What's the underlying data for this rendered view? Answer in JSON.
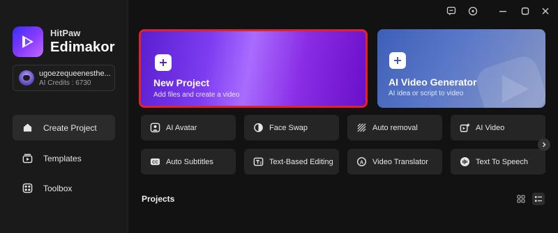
{
  "app": {
    "brand_small": "HitPaw",
    "brand_big": "Edimakor",
    "logo_icon": "play-triangle-icon"
  },
  "account": {
    "name": "ugoezequeenesthe...",
    "credits": "AI Credits : 6730"
  },
  "sidebar": {
    "items": [
      {
        "label": "Create Project",
        "icon": "home-icon",
        "active": true
      },
      {
        "label": "Templates",
        "icon": "templates-icon",
        "active": false
      },
      {
        "label": "Toolbox",
        "icon": "toolbox-icon",
        "active": false
      }
    ]
  },
  "titlebar": {
    "icons": [
      "feedback-icon",
      "settings-icon",
      "minimize-icon",
      "maximize-icon",
      "close-icon"
    ]
  },
  "hero": {
    "new_project": {
      "title": "New Project",
      "subtitle": "Add files and create a video"
    },
    "ai_video_generator": {
      "title": "AI Video Generator",
      "subtitle": "AI idea or script to video"
    }
  },
  "tools": [
    {
      "label": "AI Avatar",
      "icon": "avatar-icon"
    },
    {
      "label": "Face Swap",
      "icon": "face-swap-icon"
    },
    {
      "label": "Auto removal",
      "icon": "auto-removal-icon"
    },
    {
      "label": "AI Video",
      "icon": "ai-video-icon"
    },
    {
      "label": "Auto Subtitles",
      "icon": "cc-icon"
    },
    {
      "label": "Text-Based Editing",
      "icon": "text-edit-icon"
    },
    {
      "label": "Video Translator",
      "icon": "translate-icon"
    },
    {
      "label": "Text To Speech",
      "icon": "speech-icon"
    }
  ],
  "projects": {
    "title": "Projects",
    "view_modes": [
      "grid-view-icon",
      "list-view-icon"
    ]
  },
  "colors": {
    "highlight_border": "#e0222a",
    "new_project_accent": "#8a2ee6",
    "ai_card_accent": "#5c79c9"
  }
}
